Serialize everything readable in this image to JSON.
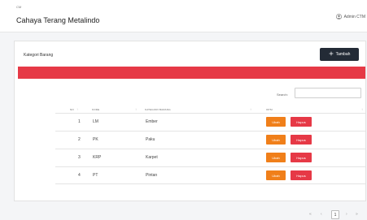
{
  "header": {
    "pre_title": "CM",
    "app_title": "Cahaya Terang Metalindo",
    "user_name": "Admin CTM"
  },
  "card": {
    "title": "Kategori Barang",
    "add_button_label": "Tambah"
  },
  "search": {
    "label": "Search:",
    "value": ""
  },
  "table": {
    "headers": [
      "NO",
      "KODE",
      "KATEGORI BARANG",
      "OPSI"
    ],
    "rows": [
      {
        "no": "1",
        "kode": "LM",
        "kategori": "Ember",
        "edit_label": "Ubah",
        "delete_label": "Hapus"
      },
      {
        "no": "2",
        "kode": "PK",
        "kategori": "Paku",
        "edit_label": "Ubah",
        "delete_label": "Hapus"
      },
      {
        "no": "3",
        "kode": "KRP",
        "kategori": "Karpet",
        "edit_label": "Ubah",
        "delete_label": "Hapus"
      },
      {
        "no": "4",
        "kode": "PT",
        "kategori": "Pintan",
        "edit_label": "Ubah",
        "delete_label": "Hapus"
      }
    ]
  },
  "pagination": {
    "first": "«",
    "prev": "‹",
    "current": "1",
    "next": "›",
    "last": "»"
  },
  "colors": {
    "alert": "#e63946",
    "edit": "#f07f1a",
    "delete": "#e63946",
    "add_button": "#232b36"
  },
  "icons": {
    "user": "user-circle-icon",
    "add": "plus-icon"
  }
}
